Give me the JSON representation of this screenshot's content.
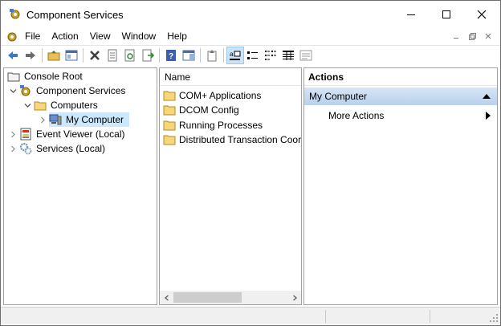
{
  "window": {
    "title": "Component Services"
  },
  "menubar": {
    "items": [
      "File",
      "Action",
      "View",
      "Window",
      "Help"
    ]
  },
  "toolbar": {
    "buttons": [
      "back",
      "forward",
      "up-folder",
      "show-hide-console-tree",
      "delete",
      "properties",
      "refresh",
      "export-list",
      "help",
      "show-hide-action-pane",
      "up-one-level",
      "large-icons",
      "small-icons",
      "list-view",
      "detail-view",
      "custom-view"
    ]
  },
  "tree": {
    "nodes": [
      {
        "label": "Console Root",
        "icon": "folder-icon",
        "level": 0,
        "expander": "none"
      },
      {
        "label": "Component Services",
        "icon": "component-services-icon",
        "level": 1,
        "expander": "expanded"
      },
      {
        "label": "Computers",
        "icon": "folder-icon",
        "level": 2,
        "expander": "expanded"
      },
      {
        "label": "My Computer",
        "icon": "my-computer-icon",
        "level": 3,
        "expander": "collapsed",
        "selected": true
      },
      {
        "label": "Event Viewer (Local)",
        "icon": "event-viewer-icon",
        "level": 1,
        "expander": "collapsed"
      },
      {
        "label": "Services (Local)",
        "icon": "services-gear-icon",
        "level": 1,
        "expander": "collapsed"
      }
    ]
  },
  "list": {
    "header": "Name",
    "items": [
      "COM+ Applications",
      "DCOM Config",
      "Running Processes",
      "Distributed Transaction Coord"
    ]
  },
  "actions": {
    "header": "Actions",
    "section": "My Computer",
    "items": [
      "More Actions"
    ]
  },
  "colors": {
    "selection": "#cce8ff",
    "action_section": "#b9d1ec",
    "folder": "#e8c05a"
  }
}
